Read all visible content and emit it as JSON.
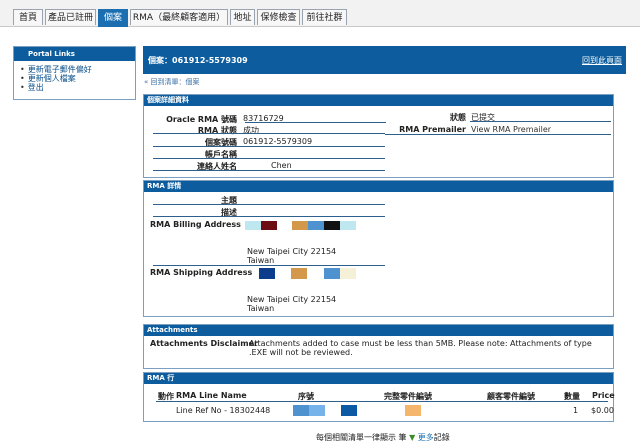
{
  "tabs": [
    "首頁",
    "產品已註冊",
    "個案",
    "RMA（最終顧客適用）",
    "地址",
    "保修檢查",
    "前往社群"
  ],
  "portal_links": {
    "title": "Portal Links",
    "items": [
      "更新電子郵件偏好",
      "更新個人檔案",
      "登出"
    ]
  },
  "case_header": {
    "title": "個案：061912-5579309",
    "right_link": "回到此頁面"
  },
  "back_link": "« 回到清單：個案",
  "case_details": {
    "heading": "個案詳細資料",
    "oracle_rma_label": "Oracle RMA 號碼",
    "oracle_rma_value": "83716729",
    "status_label": "狀態",
    "status_value": "已提交",
    "rma_status_label": "RMA 狀態",
    "rma_status_value": "成功",
    "rma_premailer_label": "RMA Premailer",
    "rma_premailer_value": "View RMA Premailer",
    "case_number_label": "個案號碼",
    "case_number_value": "061912-5579309",
    "account_label": "帳戶名稱",
    "account_value": "",
    "contact_label": "連絡人姓名",
    "contact_value": "Chen"
  },
  "rma_details": {
    "heading": "RMA 詳情",
    "subject_label": "主題",
    "description_label": "描述",
    "billing_label": "RMA Billing Address",
    "billing_city": "New Taipei City 22154",
    "billing_country": "Taiwan",
    "shipping_label": "RMA Shipping Address",
    "shipping_city": "New Taipei City 22154",
    "shipping_country": "Taiwan"
  },
  "attachments": {
    "heading": "Attachments",
    "disclaimer_label": "Attachments Disclaimer",
    "disclaimer_text": "Attachments added to case must be less than 5MB. Please note: Attachments of type .EXE will not be reviewed."
  },
  "rma_lines": {
    "heading": "RMA 行",
    "columns": [
      "動作",
      "RMA Line Name",
      "序號",
      "完整零件編號",
      "顧客零件編號",
      "數量",
      "Price"
    ],
    "rows": [
      {
        "name": "Line Ref No - 18302448",
        "qty": "1",
        "price": "$0.00"
      }
    ]
  },
  "footer": {
    "text": "每個相關清單一律顯示 筆",
    "more": "更多",
    "suffix": "記錄"
  }
}
